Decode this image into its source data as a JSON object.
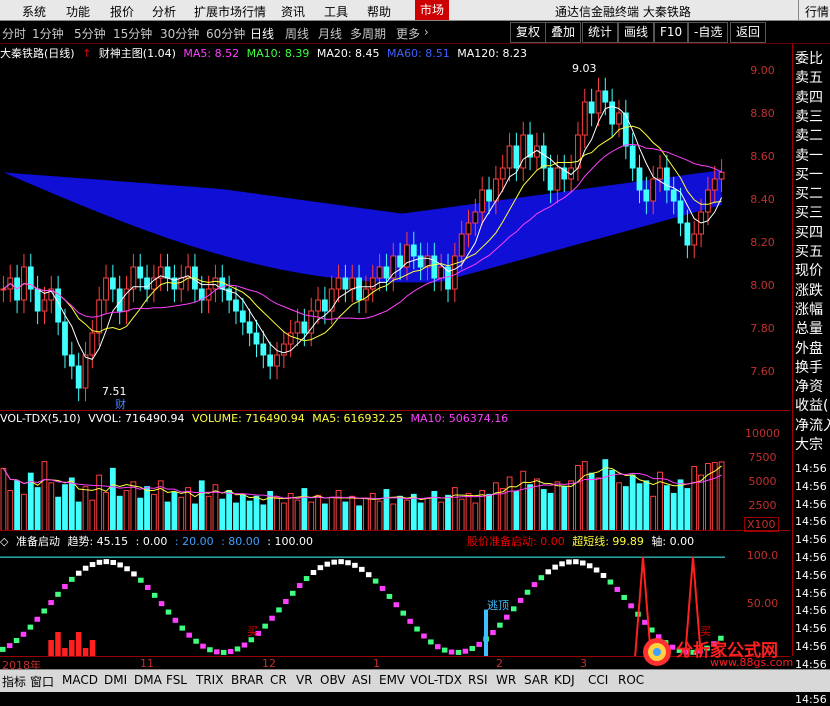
{
  "menu": {
    "items": [
      "系统",
      "功能",
      "报价",
      "分析",
      "扩展市场行情",
      "资讯",
      "工具",
      "帮助"
    ],
    "market": "市场",
    "title": "通达信金融终端  大秦铁路",
    "quote": "行情"
  },
  "periods": [
    "分时",
    "1分钟",
    "5分钟",
    "15分钟",
    "30分钟",
    "60分钟",
    "日线",
    "周线",
    "月线",
    "多周期",
    "更多"
  ],
  "active_period": "日线",
  "toolbar": [
    "复权",
    "叠加",
    "统计",
    "画线",
    "F10",
    "-自选",
    "返回"
  ],
  "main_header": {
    "name": "大秦铁路(日线)",
    "indicator": "财神主图(1.04)",
    "ma5": "MA5: 8.52",
    "ma10": "MA10: 8.39",
    "ma20": "MA20: 8.45",
    "ma60": "MA60: 8.51",
    "ma120": "MA120: 8.23"
  },
  "main_axis": [
    "9.00",
    "8.80",
    "8.60",
    "8.40",
    "8.20",
    "8.00",
    "7.80",
    "7.60"
  ],
  "main_marks": {
    "high": "9.03",
    "low": "7.51",
    "cai": "财"
  },
  "vol_header": {
    "name": "VOL-TDX(5,10)",
    "vvol": "VVOL: 716490.94",
    "volume": "VOLUME: 716490.94",
    "ma5": "MA5: 616932.25",
    "ma10": "MA10: 506374.16"
  },
  "vol_axis": [
    "10000",
    "7500",
    "5000",
    "2500"
  ],
  "vol_unit": "X100",
  "ind_header": {
    "name": "准备启动",
    "trend": "趋势: 45.15",
    "v0": ": 0.00",
    "v20": ": 20.00",
    "v80": ": 80.00",
    "v100": ": 100.00",
    "start": "股价准备启动: 0.00",
    "short": "超短线: 99.89",
    "axis": "轴: 0.00"
  },
  "ind_axis": [
    "100.0",
    "50.00"
  ],
  "ind_marks": {
    "buy1": "买",
    "buy2": "买",
    "escape": "逃顶"
  },
  "dates": [
    "2018年",
    "11",
    "12",
    "1",
    "2",
    "3"
  ],
  "right_panel": [
    "委比",
    "卖五",
    "卖四",
    "卖三",
    "卖二",
    "卖一",
    "买一",
    "买二",
    "买三",
    "买四",
    "买五",
    "现价",
    "涨跌",
    "涨幅",
    "总量",
    "外盘",
    "换手",
    "净资",
    "收益(",
    "净流入",
    "大宗"
  ],
  "times": [
    "14:56",
    "14:56",
    "14:56",
    "14:56",
    "14:56",
    "14:56",
    "14:56",
    "14:56",
    "14:56",
    "14:56",
    "14:56",
    "14:56",
    "14:56",
    "14:56"
  ],
  "tabs": [
    "指标",
    "窗口",
    "MACD",
    "DMI",
    "DMA",
    "FSL",
    "TRIX",
    "BRAR",
    "CR",
    "VR",
    "OBV",
    "ASI",
    "EMV",
    "VOL-TDX",
    "RSI",
    "WR",
    "SAR",
    "KDJ",
    "CCI",
    "ROC"
  ],
  "watermark": {
    "line1": "分析家公式网",
    "line2": "www.88gs.com"
  },
  "chart_data": [
    {
      "type": "candlestick",
      "title": "大秦铁路(日线)",
      "ylim": [
        7.5,
        9.1
      ],
      "close": [
        8.05,
        8.1,
        8.0,
        8.15,
        8.05,
        7.95,
        8.0,
        8.05,
        7.9,
        7.75,
        7.7,
        7.6,
        7.75,
        7.85,
        8.0,
        8.1,
        8.05,
        7.95,
        8.05,
        8.15,
        8.1,
        8.05,
        8.1,
        8.15,
        8.1,
        8.05,
        8.1,
        8.15,
        8.05,
        8.0,
        8.05,
        8.1,
        8.05,
        8.0,
        7.95,
        7.9,
        7.85,
        7.8,
        7.75,
        7.7,
        7.75,
        7.8,
        7.85,
        7.9,
        7.85,
        7.95,
        8.0,
        7.95,
        8.05,
        8.1,
        8.05,
        8.1,
        8.0,
        8.05,
        8.1,
        8.15,
        8.1,
        8.2,
        8.15,
        8.25,
        8.2,
        8.15,
        8.2,
        8.1,
        8.15,
        8.05,
        8.2,
        8.3,
        8.35,
        8.4,
        8.5,
        8.45,
        8.55,
        8.6,
        8.7,
        8.6,
        8.75,
        8.65,
        8.7,
        8.6,
        8.5,
        8.6,
        8.55,
        8.6,
        8.75,
        8.9,
        8.85,
        8.95,
        8.9,
        8.8,
        8.85,
        8.7,
        8.6,
        8.5,
        8.45,
        8.55,
        8.6,
        8.5,
        8.45,
        8.35,
        8.25,
        8.3,
        8.4,
        8.5,
        8.55,
        8.58
      ],
      "ma_values": {
        "MA5": 8.52,
        "MA10": 8.39,
        "MA20": 8.45,
        "MA60": 8.51,
        "MA120": 8.23
      },
      "high": 9.03,
      "low": 7.51
    },
    {
      "type": "bar",
      "title": "VOL-TDX(5,10)",
      "ylim": [
        0,
        11000
      ],
      "values": [
        6500,
        4200,
        5200,
        3800,
        6000,
        4500,
        7200,
        5000,
        3500,
        4800,
        5500,
        3000,
        4600,
        3200,
        5800,
        4000,
        6500,
        3600,
        4200,
        5100,
        3400,
        4600,
        3800,
        5200,
        3000,
        4000,
        3500,
        4500,
        2800,
        5200,
        3600,
        4800,
        3300,
        4200,
        2900,
        3800,
        3100,
        3600,
        2700,
        4100,
        3500,
        2900,
        3900,
        3200,
        4400,
        3000,
        3700,
        2800,
        3500,
        4200,
        3000,
        3600,
        2600,
        3400,
        3900,
        3100,
        4300,
        2800,
        3600,
        3200,
        3800,
        2900,
        3400,
        4100,
        3000,
        3700,
        4500,
        3300,
        3900,
        2900,
        4200,
        3800,
        5000,
        4400,
        5600,
        4100,
        6200,
        4800,
        5400,
        4300,
        3900,
        5100,
        4600,
        5200,
        6800,
        7200,
        6000,
        5500,
        7400,
        6300,
        5000,
        4600,
        5800,
        4900,
        5200,
        3600,
        6100,
        4700,
        3900,
        5300,
        4400,
        6700,
        5800,
        7000,
        7100,
        7167
      ],
      "series_labels": {
        "VOLUME": 716490.94,
        "MA5": 616932.25,
        "MA10": 506374.16
      }
    }
  ]
}
